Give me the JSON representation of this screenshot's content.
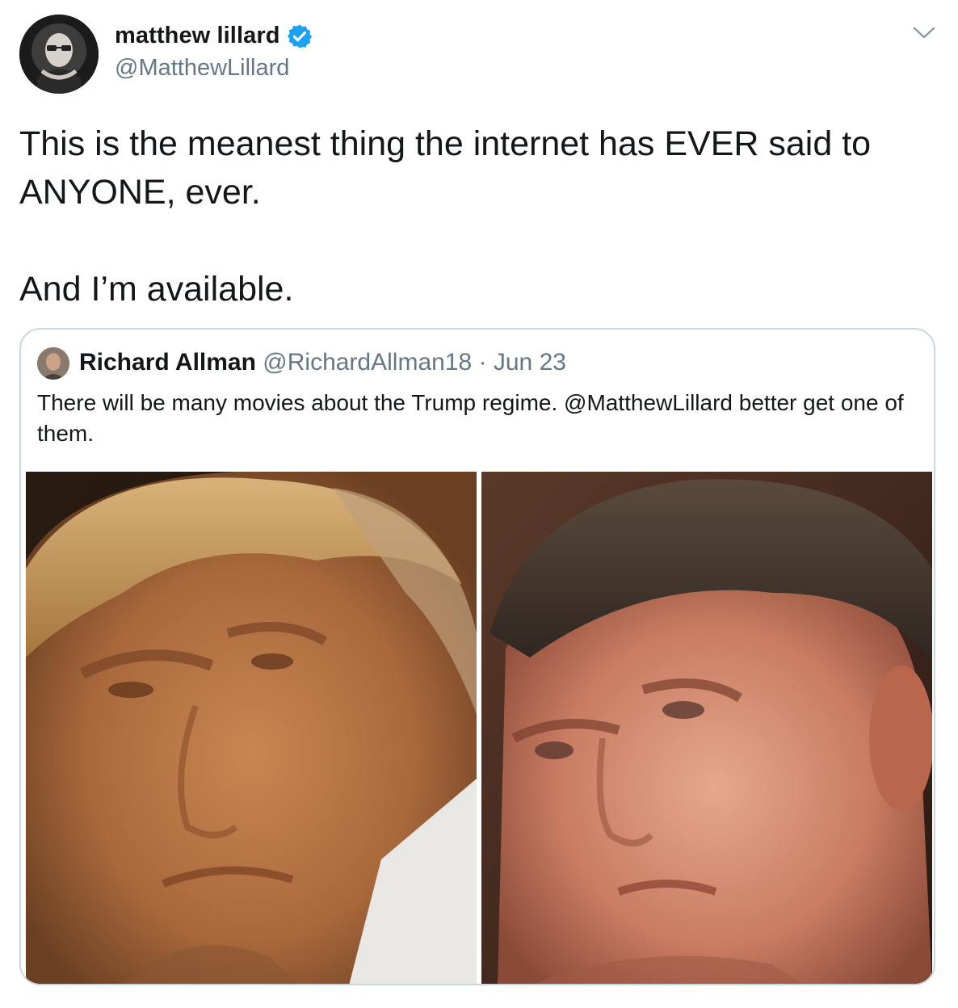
{
  "tweet": {
    "author": {
      "display_name": "matthew lillard",
      "handle": "@MatthewLillard",
      "verified": true
    },
    "menu_icon": "chevron-down-icon",
    "text_lines": [
      "This is the meanest thing the internet has EVER said to ANYONE, ever.",
      "And I’m available."
    ],
    "quoted": {
      "display_name": "Richard Allman",
      "handle": "@RichardAllman18",
      "separator": "·",
      "date": "Jun 23",
      "text": "There will be many movies about the Trump regime. @MatthewLillard better get one of them.",
      "photos": [
        {
          "icon": "photo-left-face"
        },
        {
          "icon": "photo-right-face"
        }
      ]
    }
  },
  "colors": {
    "text_primary": "#14171a",
    "text_secondary": "#657786",
    "verified_blue": "#1da1f2",
    "card_border": "#ccd6dd"
  }
}
